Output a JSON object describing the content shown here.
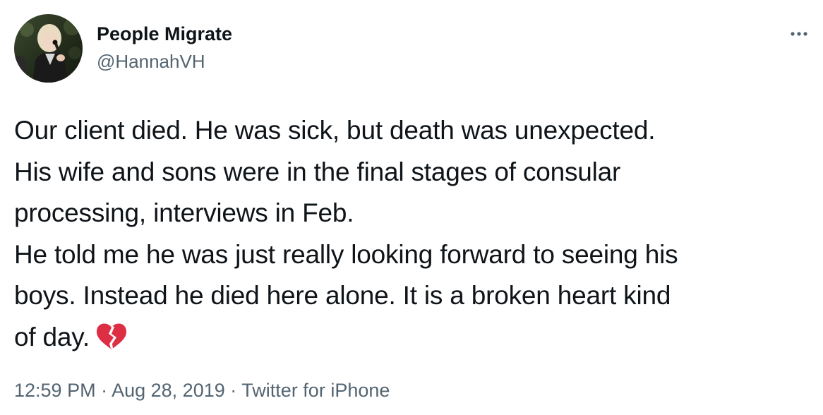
{
  "author": {
    "display_name": "People Migrate",
    "handle": "@HannahVH",
    "avatar_icon": "profile-photo",
    "more_icon": "more-horizontal-icon"
  },
  "tweet": {
    "lines": [
      "Our client died. He was sick, but death was unexpected.",
      "His wife and sons were in the final stages of consular",
      "processing, interviews in Feb.",
      "He told me he was just really looking forward to seeing his",
      "boys. Instead he died here alone. It is a broken heart kind",
      "of day."
    ],
    "emoji": "broken-heart-icon",
    "emoji_color": "#dd2e44"
  },
  "meta": {
    "time": "12:59 PM",
    "separator": "·",
    "date": "Aug 28, 2019",
    "source": "Twitter for iPhone",
    "color": "#536471"
  }
}
